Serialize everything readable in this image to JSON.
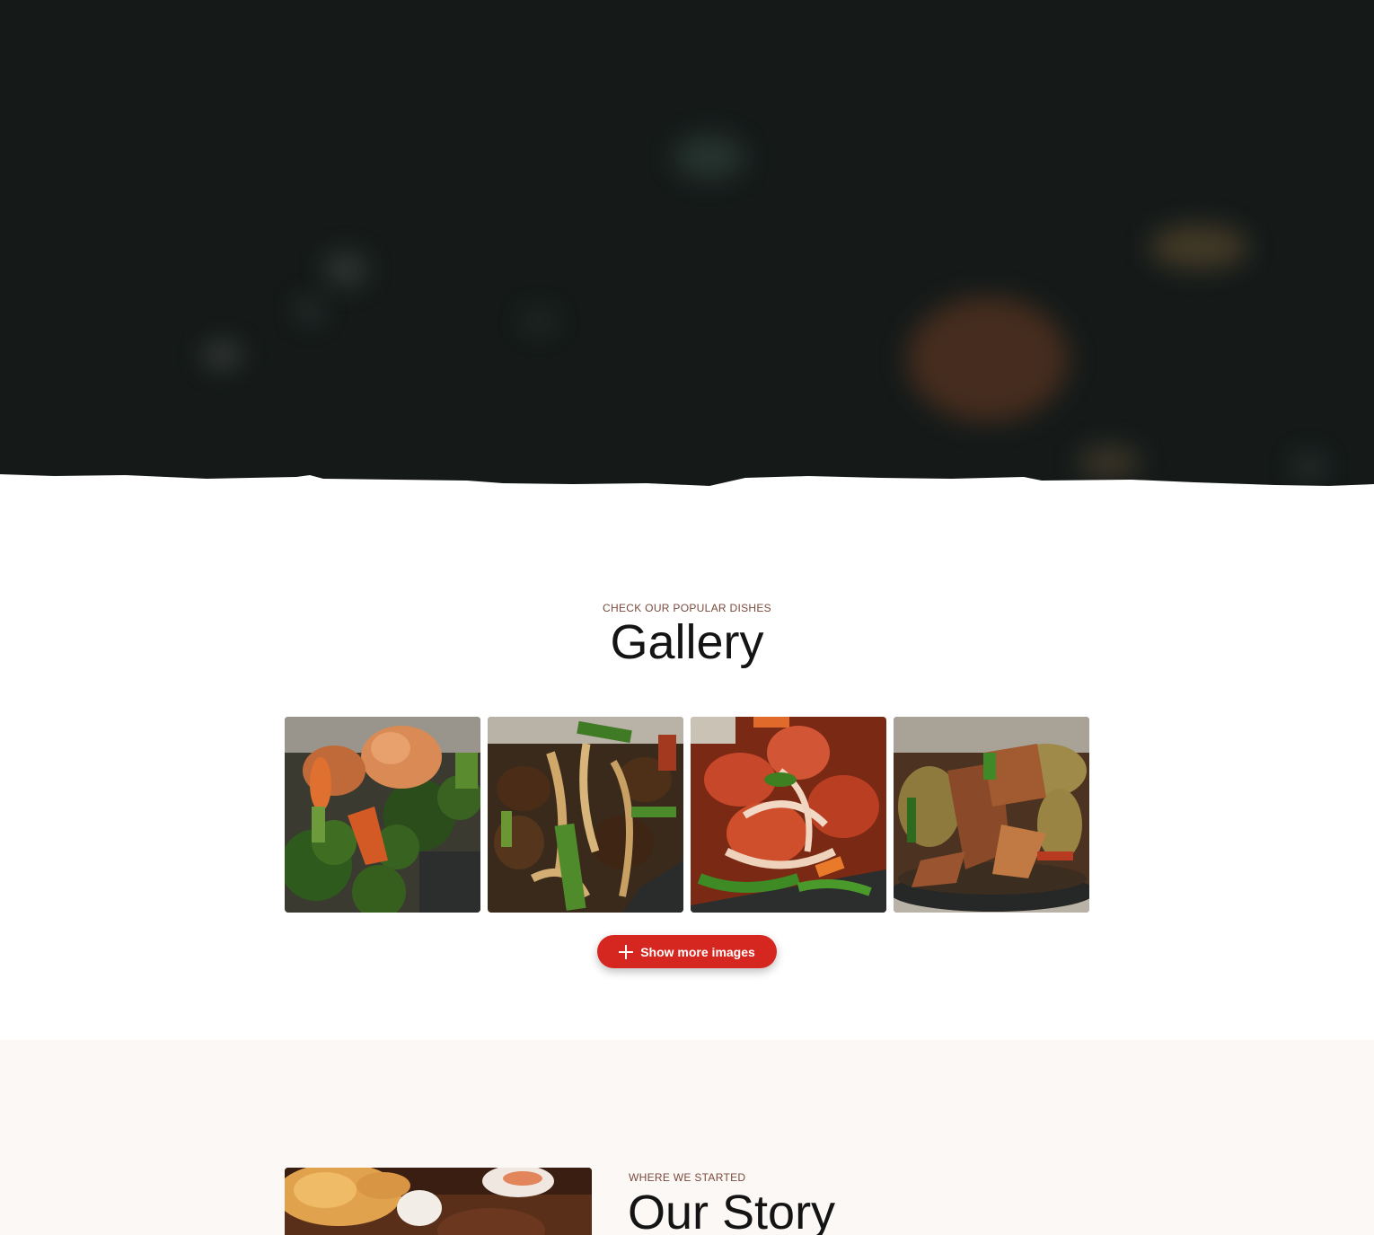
{
  "gallery": {
    "eyebrow": "CHECK OUR POPULAR DISHES",
    "title": "Gallery",
    "images": [
      {
        "alt": "Shrimp with broccoli"
      },
      {
        "alt": "Beef with onions and peppers"
      },
      {
        "alt": "Sweet and sour dish with onions"
      },
      {
        "alt": "Stir-fried pork with cabbage"
      }
    ],
    "show_more_label": "Show more images",
    "show_more_icon": "plus-icon"
  },
  "story": {
    "eyebrow": "WHERE WE STARTED",
    "title": "Our Story"
  },
  "colors": {
    "hero_background": "#151a19",
    "accent": "#d5261f",
    "eyebrow": "#7a4a3d",
    "story_background": "#fcf8f6"
  }
}
